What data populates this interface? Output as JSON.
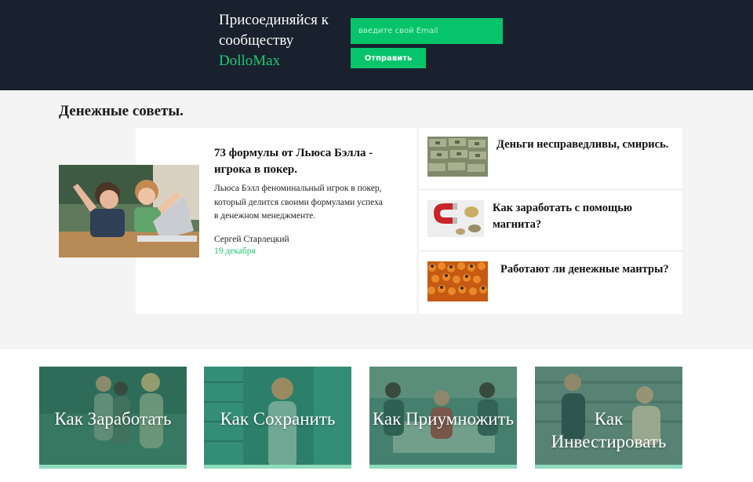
{
  "subscribe": {
    "title": "Присоединяйся к сообществу",
    "brand": "DolloMax",
    "email_placeholder": "введите свой Email",
    "submit_label": "Отправить"
  },
  "tips": {
    "heading": "Денежные советы.",
    "featured": {
      "title": "73 формулы от Льюса Бэлла - игрока в покер.",
      "excerpt": "Льюса Бэлл феноминальный игрок в покер, который делится своими формулами успеха в денежном менеджменте.",
      "author": "Сергей Старлецкий",
      "date": "19 декабря"
    },
    "side": [
      {
        "title": "Деньги несправедливы, смирись."
      },
      {
        "title": "Как заработать с помощью магнита?"
      },
      {
        "title": "Работают ли денежные мантры?"
      }
    ]
  },
  "categories": [
    {
      "label": "Как Заработать"
    },
    {
      "label": "Как Сохранить"
    },
    {
      "label": "Как Приумножить"
    },
    {
      "label": "Как Инвестировать"
    }
  ],
  "colors": {
    "header_bg": "#18212d",
    "accent": "#06c46a",
    "brand_text": "#1ec971",
    "section_bg": "#f4f4f4",
    "tile_overlay": "#2d8a70"
  }
}
